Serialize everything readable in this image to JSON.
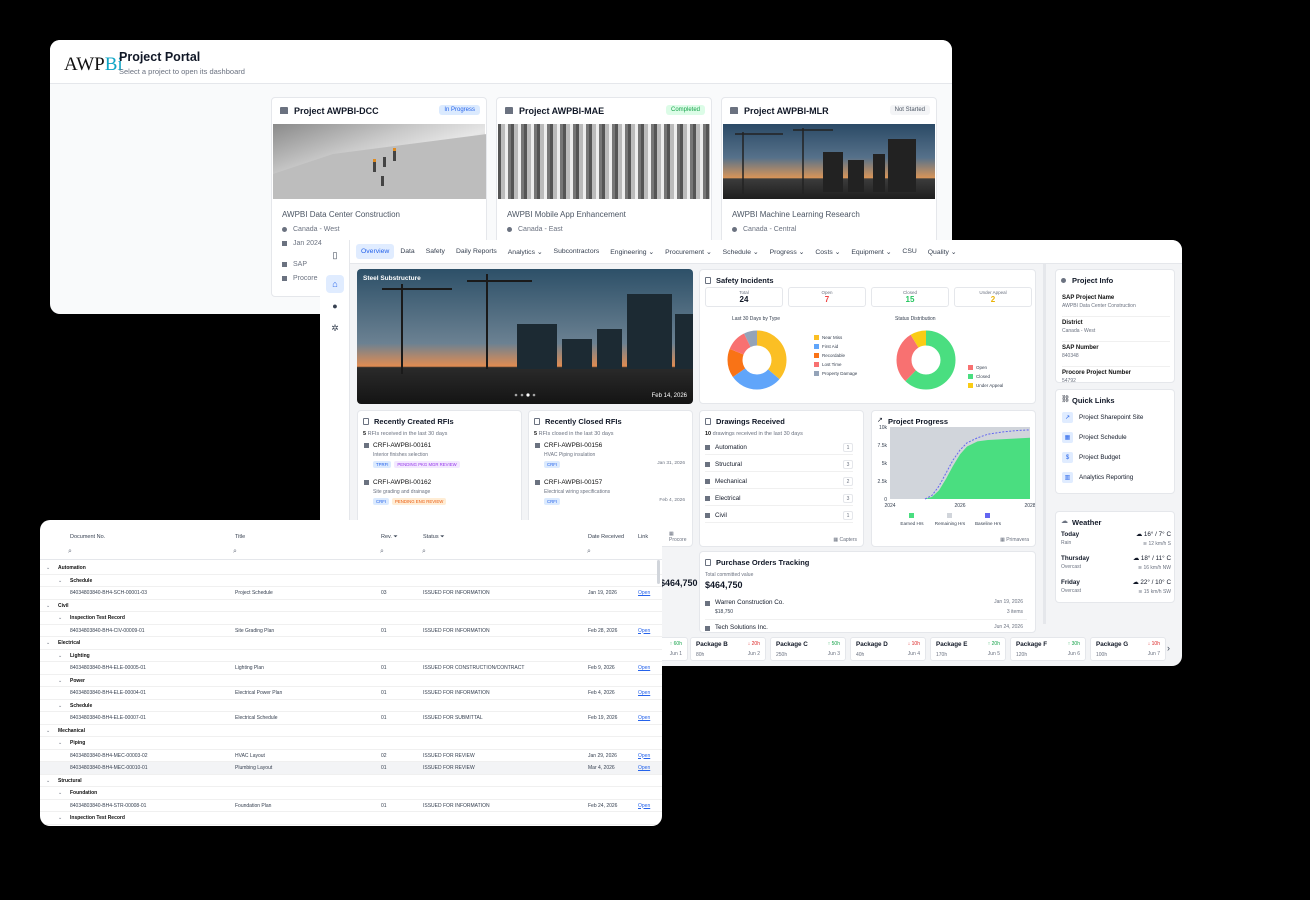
{
  "portal": {
    "logo_text": "AWP",
    "logo_accent": "Bi",
    "title": "Project Portal",
    "subtitle": "Select a project to open its dashboard",
    "cards": [
      {
        "title": "Project AWPBI-DCC",
        "status": "In Progress",
        "status_bg": "#dbeafe",
        "status_color": "#2563eb",
        "name": "AWPBI Data Center Construction",
        "location": "Canada - West",
        "date": "Jan 2024",
        "sources": [
          "SAP",
          "Procore"
        ]
      },
      {
        "title": "Project AWPBI-MAE",
        "status": "Completed",
        "status_bg": "#dcfce7",
        "status_color": "#16a34a",
        "name": "AWPBI Mobile App Enhancement",
        "location": "Canada - East"
      },
      {
        "title": "Project AWPBI-MLR",
        "status": "Not Started",
        "status_bg": "#f3f4f6",
        "status_color": "#4b5563",
        "name": "AWPBI Machine Learning Research",
        "location": "Canada - Central"
      }
    ]
  },
  "dashboard": {
    "tabs": [
      "Overview",
      "Data",
      "Safety",
      "Daily Reports",
      "Analytics ⌄",
      "Subcontractors",
      "Engineering ⌄",
      "Procurement ⌄",
      "Schedule ⌄",
      "Progress ⌄",
      "Costs ⌄",
      "Equipment ⌄",
      "CSU",
      "Quality ⌄"
    ],
    "hero": {
      "label": "Steel Substructure",
      "date": "Feb 14, 2026"
    },
    "safety": {
      "title": "Safety Incidents",
      "stats": [
        {
          "label": "Total",
          "value": "24",
          "color": "#111827"
        },
        {
          "label": "Open",
          "value": "7",
          "color": "#ef4444"
        },
        {
          "label": "Closed",
          "value": "15",
          "color": "#22c55e"
        },
        {
          "label": "Under Appeal",
          "value": "2",
          "color": "#eab308"
        }
      ],
      "type_chart": {
        "title": "Last 30 Days by Type",
        "legend": [
          {
            "name": "Near Miss",
            "color": "#fbbf24"
          },
          {
            "name": "First Aid",
            "color": "#60a5fa"
          },
          {
            "name": "Recordable",
            "color": "#f97316"
          },
          {
            "name": "Lost Time",
            "color": "#f87171"
          },
          {
            "name": "Property Damage",
            "color": "#94a3b8"
          }
        ]
      },
      "status_chart": {
        "title": "Status Distribution",
        "legend": [
          {
            "name": "Open",
            "color": "#f87171"
          },
          {
            "name": "Closed",
            "color": "#4ade80"
          },
          {
            "name": "Under Appeal",
            "color": "#facc15"
          }
        ]
      }
    },
    "info": {
      "title": "Project Info",
      "fields": [
        {
          "label": "SAP Project Name",
          "value": "AWPBI Data Center Construction"
        },
        {
          "label": "District",
          "value": "Canada - West"
        },
        {
          "label": "SAP Number",
          "value": "840348"
        },
        {
          "label": "Procore Project Number",
          "value": "54792"
        }
      ]
    },
    "links": {
      "title": "Quick Links",
      "items": [
        {
          "label": "Project Sharepoint Site",
          "icon": "↗"
        },
        {
          "label": "Project Schedule",
          "icon": "▦"
        },
        {
          "label": "Project Budget",
          "icon": "$"
        },
        {
          "label": "Analytics Reporting",
          "icon": "▥"
        }
      ]
    },
    "weather": {
      "title": "Weather",
      "days": [
        {
          "day": "Today",
          "cond": "Rain",
          "temp": "16° / 7° C",
          "wind": "12 km/h S"
        },
        {
          "day": "Thursday",
          "cond": "Overcast",
          "temp": "18° / 11° C",
          "wind": "16 km/h NW"
        },
        {
          "day": "Friday",
          "cond": "Overcast",
          "temp": "22° / 10° C",
          "wind": "15 km/h SW"
        }
      ]
    },
    "rfis_created": {
      "title": "Recently Created RFIs",
      "count": "5",
      "sub": "RFIs received in the last 30 days",
      "items": [
        {
          "id": "CRFI-AWPBI-00161",
          "desc": "Interior finishes selection",
          "tags": [
            "TPRFI",
            "PENDING PKG MGR REVIEW"
          ]
        },
        {
          "id": "CRFI-AWPBI-00162",
          "desc": "Site grading and drainage",
          "tags": [
            "CRFI",
            "PENDING ENG REVIEW"
          ]
        }
      ]
    },
    "rfis_closed": {
      "title": "Recently Closed RFIs",
      "count": "5",
      "sub": "RFIs closed in the last 30 days",
      "items": [
        {
          "id": "CRFI-AWPBI-00156",
          "desc": "HVAC Piping insulation",
          "tag": "CRFI",
          "date": "Jan 31, 2026"
        },
        {
          "id": "CRFI-AWPBI-00157",
          "desc": "Electrical wiring specifications",
          "tag": "CRFI",
          "date": "Feb 4, 2026"
        }
      ]
    },
    "drawings": {
      "title": "Drawings Received",
      "count": "10",
      "sub": "drawings received in the last 30 days",
      "items": [
        {
          "name": "Automation",
          "count": "1"
        },
        {
          "name": "Structural",
          "count": "3"
        },
        {
          "name": "Mechanical",
          "count": "2"
        },
        {
          "name": "Electrical",
          "count": "3"
        },
        {
          "name": "Civil",
          "count": "1"
        }
      ],
      "source": "Capters"
    },
    "progress": {
      "title": "Project Progress",
      "source": "Primavera",
      "legend": [
        "Earned Hrs",
        "Remaining Hrs",
        "Baseline Hrs"
      ]
    },
    "po": {
      "title": "Purchase Orders Tracking",
      "total_label": "Total committed value",
      "total": "$464,750",
      "items": [
        {
          "name": "Warren Construction Co.",
          "value": "$18,750",
          "date": "Jan 19, 2026",
          "count": "3 items"
        },
        {
          "name": "Tech Solutions Inc.",
          "date": "Jun 24, 2026"
        }
      ]
    },
    "packages": [
      {
        "name": "Package B",
        "delta": "↓ 20h",
        "dir": "dn",
        "hrs": "80h",
        "date": "Jun 2"
      },
      {
        "name": "Package C",
        "delta": "↑ 50h",
        "dir": "up",
        "hrs": "250h",
        "date": "Jun 3"
      },
      {
        "name": "Package D",
        "delta": "↓ 10h",
        "dir": "dn",
        "hrs": "40h",
        "date": "Jun 4"
      },
      {
        "name": "Package E",
        "delta": "↑ 20h",
        "dir": "up",
        "hrs": "170h",
        "date": "Jun 5"
      },
      {
        "name": "Package F",
        "delta": "↑ 30h",
        "dir": "up",
        "hrs": "120h",
        "date": "Jun 6"
      },
      {
        "name": "Package G",
        "delta": "↓ 10h",
        "dir": "dn",
        "hrs": "100h",
        "date": "Jun 7"
      }
    ],
    "pkg_partial": {
      "delta": "↑ 60h",
      "date": "Jun 1"
    },
    "partial_total": "$464,750"
  },
  "chart_data": {
    "type": "area",
    "title": "Project Progress",
    "x_ticks": [
      "2024",
      "2026",
      "2028"
    ],
    "y_ticks": [
      "10k",
      "7.5k",
      "5k",
      "2.5k",
      "0"
    ],
    "ylim": [
      0,
      10000
    ],
    "series": [
      {
        "name": "Earned Hrs",
        "color": "#4ade80"
      },
      {
        "name": "Remaining Hrs",
        "color": "#d1d5db"
      },
      {
        "name": "Baseline Hrs",
        "color": "#6366f1"
      }
    ],
    "x": [
      2025.0,
      2025.2,
      2025.4,
      2025.6,
      2025.8,
      2026.0,
      2026.2,
      2026.5,
      2026.8,
      2027.2,
      2027.6,
      2028.0
    ],
    "earned": [
      0,
      300,
      1200,
      2800,
      4600,
      6200,
      7300,
      8000,
      8200,
      8300,
      8400,
      8500
    ],
    "baseline": [
      0,
      500,
      1800,
      3600,
      5400,
      6800,
      7800,
      8500,
      9000,
      9300,
      9500,
      9600
    ]
  },
  "table": {
    "headers": [
      "Document No.",
      "Title",
      "Rev.",
      "Status",
      "Date Received",
      "Link"
    ],
    "rows": [
      {
        "lvl": 0,
        "text": "Automation"
      },
      {
        "lvl": 1,
        "text": "Schedule"
      },
      {
        "doc": "84034803840-BH4-SCH-00001-03",
        "title": "Project Schedule",
        "rev": "03",
        "status": "ISSUED FOR INFORMATION",
        "date": "Jan 19, 2026",
        "link": "Open"
      },
      {
        "lvl": 0,
        "text": "Civil"
      },
      {
        "lvl": 1,
        "text": "Inspection Test Record"
      },
      {
        "doc": "84034803840-BH4-CIV-00009-01",
        "title": "Site Grading Plan",
        "rev": "01",
        "status": "ISSUED FOR INFORMATION",
        "date": "Feb 28, 2026",
        "link": "Open"
      },
      {
        "lvl": 0,
        "text": "Electrical"
      },
      {
        "lvl": 1,
        "text": "Lighting"
      },
      {
        "doc": "84034803840-BH4-ELE-00005-01",
        "title": "Lighting Plan",
        "rev": "01",
        "status": "ISSUED FOR CONSTRUCTION/CONTRACT",
        "date": "Feb 9, 2026",
        "link": "Open"
      },
      {
        "lvl": 1,
        "text": "Power"
      },
      {
        "doc": "84034803840-BH4-ELE-00004-01",
        "title": "Electrical Power Plan",
        "rev": "01",
        "status": "ISSUED FOR INFORMATION",
        "date": "Feb 4, 2026",
        "link": "Open"
      },
      {
        "lvl": 1,
        "text": "Schedule"
      },
      {
        "doc": "84034803840-BH4-ELE-00007-01",
        "title": "Electrical Schedule",
        "rev": "01",
        "status": "ISSUED FOR SUBMITTAL",
        "date": "Feb 19, 2026",
        "link": "Open"
      },
      {
        "lvl": 0,
        "text": "Mechanical"
      },
      {
        "lvl": 1,
        "text": "Piping"
      },
      {
        "doc": "84034803840-BH4-MEC-00003-02",
        "title": "HVAC Layout",
        "rev": "02",
        "status": "ISSUED FOR REVIEW",
        "date": "Jan 29, 2026",
        "link": "Open"
      },
      {
        "doc": "84034803840-BH4-MEC-00010-01",
        "title": "Plumbing Layout",
        "rev": "01",
        "status": "ISSUED FOR REVIEW",
        "date": "Mar 4, 2026",
        "link": "Open",
        "hl": true
      },
      {
        "lvl": 0,
        "text": "Structural"
      },
      {
        "lvl": 1,
        "text": "Foundation"
      },
      {
        "doc": "84034803840-BH4-STR-00008-01",
        "title": "Foundation Plan",
        "rev": "01",
        "status": "ISSUED FOR INFORMATION",
        "date": "Feb 24, 2026",
        "link": "Open"
      },
      {
        "lvl": 1,
        "text": "Inspection Test Record"
      }
    ]
  }
}
